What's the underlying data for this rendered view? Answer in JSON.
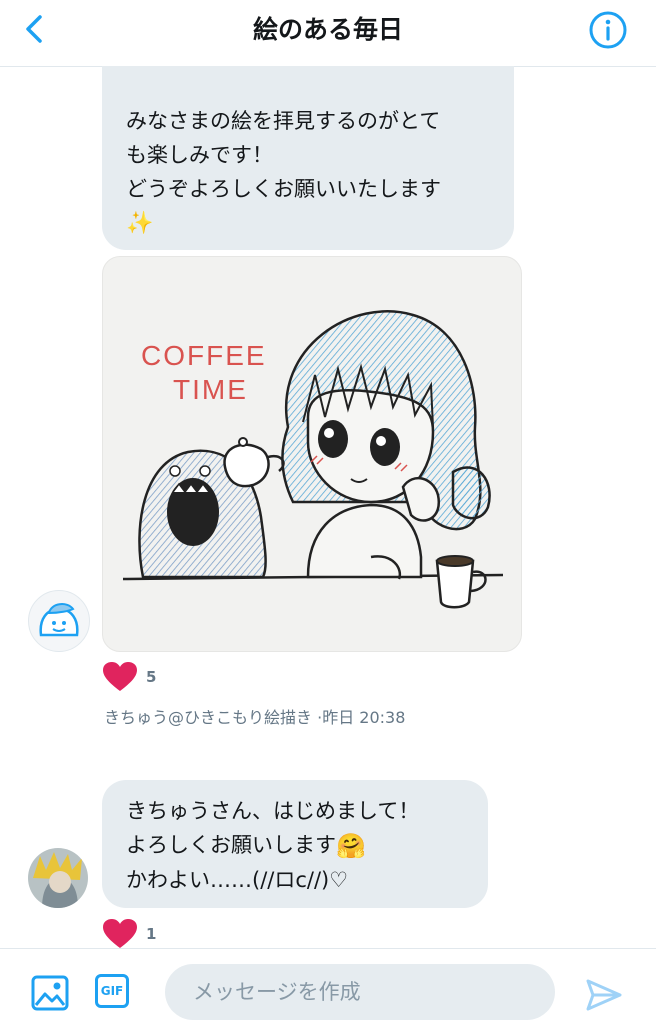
{
  "header": {
    "title": "絵のある毎日"
  },
  "messages": [
    {
      "lines": [
        "みなさまの絵を拝見するのがとて",
        "も楽しみです！",
        "どうぞよろしくお願いいたします"
      ],
      "emoji": "✨",
      "image_text": [
        "COFFEE",
        "TIME"
      ],
      "likes": "5",
      "author": "きちゅう@ひきこもり絵描き",
      "time": "·昨日 20:38"
    },
    {
      "lines": [
        "きちゅうさん、はじめまして！",
        "よろしくお願いします",
        "かわよい……(//ロc//)♡"
      ],
      "emoji": "🤗",
      "likes": "1"
    }
  ],
  "composer": {
    "gif_label": "GIF",
    "placeholder": "メッセージを作成"
  },
  "colors": {
    "accent": "#1da1f2",
    "bubble": "#e6ecf0",
    "like": "#e0245e"
  }
}
